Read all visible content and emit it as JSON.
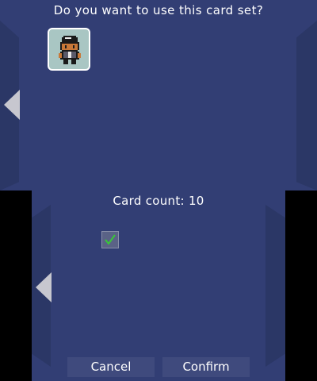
{
  "top_screen": {
    "prompt": "Do you want to use this card set?",
    "card_icon": "trainer-sprite-icon",
    "left_arrow_icon": "triangle-left-icon"
  },
  "bottom_screen": {
    "card_count_label": "Card count: 10",
    "checkbox_checked": true,
    "checkmark_icon": "checkmark-icon",
    "left_arrow_icon": "triangle-left-icon",
    "buttons": {
      "cancel": "Cancel",
      "confirm": "Confirm"
    }
  },
  "colors": {
    "background": "#323e74",
    "side_panel": "#2b3766",
    "button": "#3f4a7d",
    "checkmark": "#38c838"
  }
}
